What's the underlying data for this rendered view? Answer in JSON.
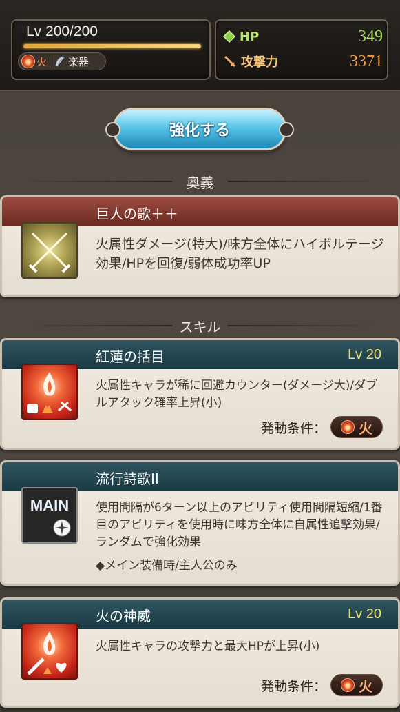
{
  "header": {
    "level": "Lv 200/200",
    "element": "火",
    "weapon_type": "楽器",
    "hp_label": "HP",
    "hp_value": "349",
    "atk_label": "攻撃力",
    "atk_value": "3371"
  },
  "enhance_button": "強化する",
  "ougi_section": {
    "title": "奥義",
    "name": "巨人の歌＋＋",
    "description": "火属性ダメージ(特大)/味方全体にハイボルテージ効果/HPを回復/弱体成功率UP"
  },
  "skill_section": {
    "title": "スキル",
    "skills": [
      {
        "name": "紅蓮の括目",
        "level": "Lv 20",
        "description": "火属性キャラが稀に回避カウンター(ダメージ大)/ダブルアタック確率上昇(小)",
        "condition_label": "発動条件：",
        "condition_element": "火"
      },
      {
        "name": "流行詩歌II",
        "icon_text": "MAIN",
        "description": "使用間隔が6ターン以上のアビリティ使用間隔短縮/1番目のアビリティを使用時に味方全体に自属性追撃効果/ランダムで強化効果",
        "note": "◆メイン装備時/主人公のみ"
      },
      {
        "name": "火の神威",
        "level": "Lv 20",
        "description": "火属性キャラの攻撃力と最大HPが上昇(小)",
        "condition_label": "発動条件：",
        "condition_element": "火"
      }
    ]
  },
  "colors": {
    "hp": "#a8e05a",
    "attack": "#f29a3c",
    "level_gold": "#f1e06a",
    "ougi_header": "#8a3e34",
    "skill_header": "#244650"
  }
}
